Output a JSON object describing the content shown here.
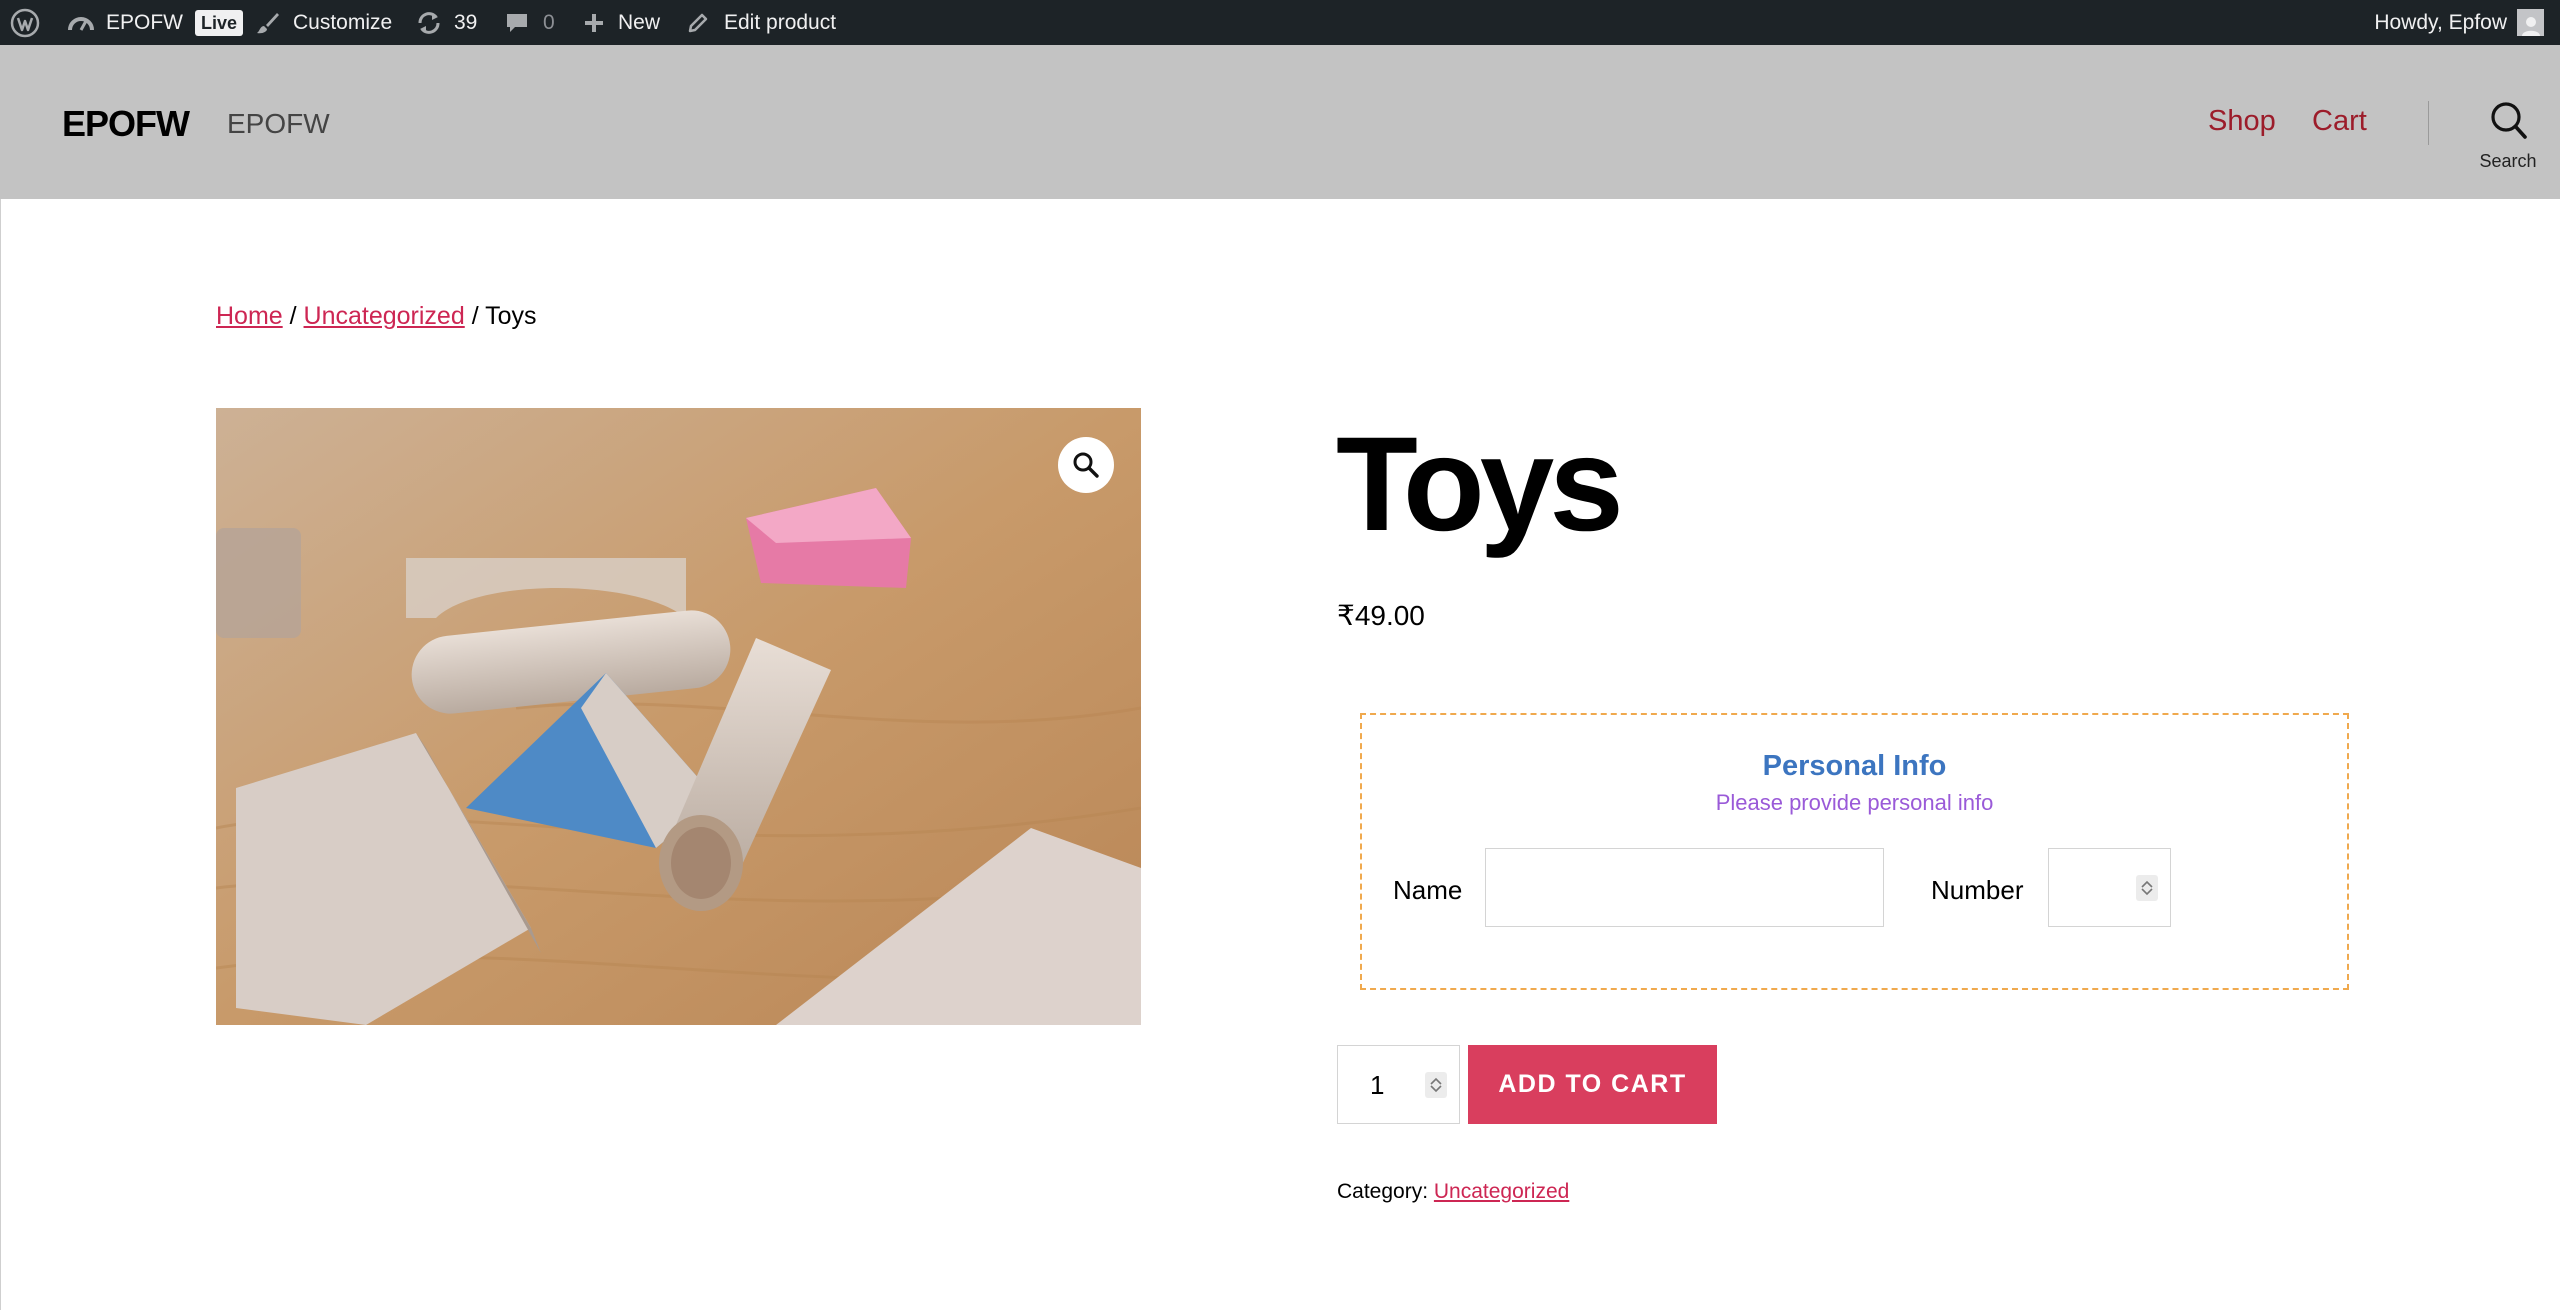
{
  "admin_bar": {
    "site_name": "EPOFW",
    "live_badge": "Live",
    "customize": "Customize",
    "updates_count": "39",
    "comments_count": "0",
    "new": "New",
    "edit_product": "Edit product",
    "howdy": "Howdy, Epfow"
  },
  "header": {
    "site_title": "EPOFW",
    "site_description": "EPOFW",
    "nav": [
      "Shop",
      "Cart"
    ],
    "search_label": "Search"
  },
  "breadcrumb": {
    "home": "Home",
    "sep1": " / ",
    "category": "Uncategorized",
    "sep2": " / ",
    "current": "Toys"
  },
  "product": {
    "title": "Toys",
    "price": "₹49.00",
    "quantity": "1",
    "add_to_cart": "ADD TO CART",
    "category_label": "Category: ",
    "category_value": "Uncategorized"
  },
  "field_group": {
    "title": "Personal Info",
    "subtitle": "Please provide personal info",
    "name_label": "Name",
    "name_value": "",
    "number_label": "Number",
    "number_value": ""
  },
  "colors": {
    "admin_bar_bg": "#1d2327",
    "header_bg": "#c3c3c3",
    "nav_link": "#9c1c2a",
    "link_accent": "#cd2653",
    "button_bg": "#d93e5e",
    "field_group_title": "#3c75c0",
    "field_group_subtitle": "#9a5ad8",
    "field_group_border": "#f0a94e"
  },
  "icons": {
    "wp_logo": "wordpress-logo-icon",
    "dashboard": "dashboard-icon",
    "customize": "paintbrush-icon",
    "updates": "refresh-icon",
    "comments": "comment-icon",
    "new": "plus-icon",
    "edit": "pencil-icon",
    "search": "search-icon",
    "zoom": "magnifier-icon"
  }
}
